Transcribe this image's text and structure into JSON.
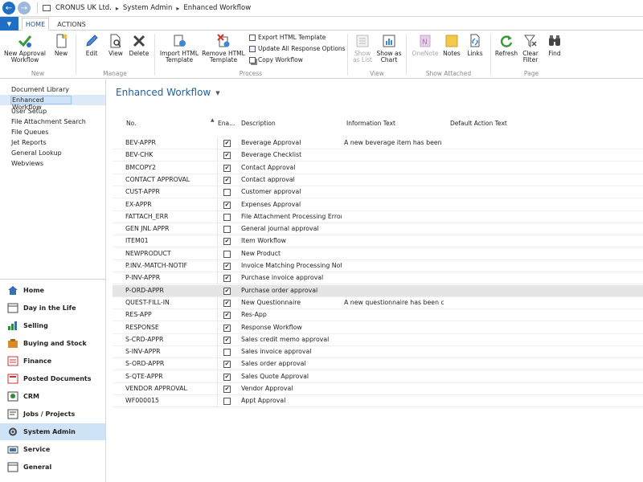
{
  "breadcrumb": [
    "CRONUS UK Ltd.",
    "System Admin",
    "Enhanced Workflow"
  ],
  "tabs": [
    {
      "label": "HOME"
    },
    {
      "label": "ACTIONS"
    }
  ],
  "ribbon": {
    "new": {
      "label": "New",
      "new_approval_workflow": "New Approval Workflow",
      "new_btn": "New"
    },
    "manage": {
      "label": "Manage",
      "edit": "Edit",
      "view": "View",
      "delete": "Delete"
    },
    "process": {
      "label": "Process",
      "import_html_template": "Import HTML Template",
      "remove_html_template": "Remove HTML Template",
      "export_html_template": "Export HTML Template",
      "update_all_response_options": "Update All Response Options",
      "copy_workflow": "Copy Workflow"
    },
    "view": {
      "label": "View",
      "show_as_list": "Show as List",
      "show_as_chart": "Show as Chart"
    },
    "show_attached": {
      "label": "Show Attached",
      "onenote": "OneNote",
      "notes": "Notes",
      "links": "Links"
    },
    "page": {
      "label": "Page",
      "refresh": "Refresh",
      "clear_filter": "Clear Filter",
      "find": "Find"
    }
  },
  "sidebar": {
    "links": [
      "Document Library",
      "Enhanced Workflow",
      "User Setup",
      "File Attachment Search",
      "File Queues",
      "Jet Reports",
      "General Lookup",
      "Webviews"
    ],
    "departments": [
      {
        "label": "Home",
        "icon": "home-icon"
      },
      {
        "label": "Day in the Life",
        "icon": "calendar-icon"
      },
      {
        "label": "Selling",
        "icon": "selling-icon"
      },
      {
        "label": "Buying and Stock",
        "icon": "buying-icon"
      },
      {
        "label": "Finance",
        "icon": "finance-icon"
      },
      {
        "label": "Posted Documents",
        "icon": "posted-documents-icon"
      },
      {
        "label": "CRM",
        "icon": "crm-icon"
      },
      {
        "label": "Jobs / Projects",
        "icon": "jobs-icon"
      },
      {
        "label": "System Admin",
        "icon": "system-admin-icon"
      },
      {
        "label": "Service",
        "icon": "service-icon"
      },
      {
        "label": "General",
        "icon": "general-icon"
      }
    ]
  },
  "page": {
    "title": "Enhanced Workflow",
    "columns": {
      "no": "No.",
      "enabled": "Ena...",
      "description": "Description",
      "information_text": "Information Text",
      "default_action_text": "Default Action Text"
    }
  },
  "rows": [
    {
      "no": "BEV-APPR",
      "enabled": true,
      "description": "Beverage Approval",
      "info": "A new beverage item has been cre..."
    },
    {
      "no": "BEV-CHK",
      "enabled": true,
      "description": "Beverage Checklist",
      "info": ""
    },
    {
      "no": "BMCOPY2",
      "enabled": true,
      "description": "Contact Approval",
      "info": ""
    },
    {
      "no": "CONTACT APPROVAL",
      "enabled": true,
      "description": "Contact approval",
      "info": ""
    },
    {
      "no": "CUST-APPR",
      "enabled": false,
      "description": "Customer approval",
      "info": ""
    },
    {
      "no": "EX-APPR",
      "enabled": true,
      "description": "Expenses Approval",
      "info": ""
    },
    {
      "no": "FATTACH_ERR",
      "enabled": false,
      "description": "File Attachment Processing Error",
      "info": ""
    },
    {
      "no": "GEN JNL APPR",
      "enabled": false,
      "description": "General journal approval",
      "info": ""
    },
    {
      "no": "ITEM01",
      "enabled": true,
      "description": "Item Workflow",
      "info": ""
    },
    {
      "no": "NEWPRODUCT",
      "enabled": false,
      "description": "New Product",
      "info": ""
    },
    {
      "no": "P.INV.-MATCH-NOTIF",
      "enabled": true,
      "description": "Invoice Matching Processing Noti...",
      "info": ""
    },
    {
      "no": "P-INV-APPR",
      "enabled": true,
      "description": "Purchase invoice approval",
      "info": ""
    },
    {
      "no": "P-ORD-APPR",
      "enabled": true,
      "description": "Purchase order approval",
      "info": "",
      "selected": true
    },
    {
      "no": "QUEST-FILL-IN",
      "enabled": true,
      "description": "New Questionnaire",
      "info": "A new questionnaire has been cre..."
    },
    {
      "no": "RES-APP",
      "enabled": true,
      "description": "Res-App",
      "info": ""
    },
    {
      "no": "RESPONSE",
      "enabled": true,
      "description": "Response Workflow",
      "info": ""
    },
    {
      "no": "S-CRD-APPR",
      "enabled": true,
      "description": "Sales credit memo approval",
      "info": ""
    },
    {
      "no": "S-INV-APPR",
      "enabled": false,
      "description": "Sales invoice approval",
      "info": ""
    },
    {
      "no": "S-ORD-APPR",
      "enabled": true,
      "description": "Sales order approval",
      "info": ""
    },
    {
      "no": "S-QTE-APPR",
      "enabled": true,
      "description": "Sales Quote Approval",
      "info": ""
    },
    {
      "no": "VENDOR APPROVAL",
      "enabled": true,
      "description": "Vendor Approval",
      "info": ""
    },
    {
      "no": "WF000015",
      "enabled": false,
      "description": "Appt Approval",
      "info": ""
    }
  ]
}
